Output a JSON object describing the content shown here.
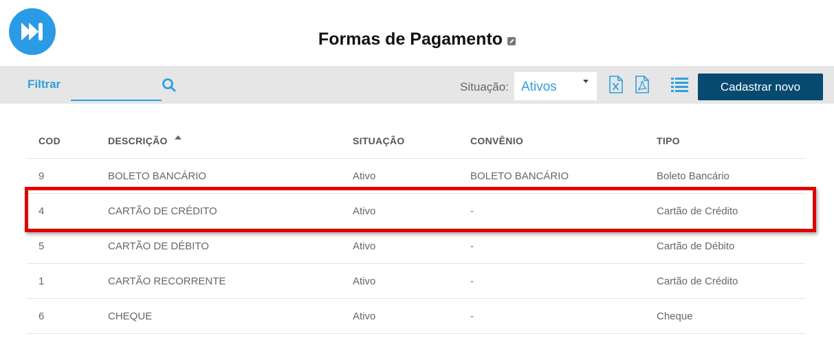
{
  "header": {
    "title": "Formas de Pagamento"
  },
  "toolbar": {
    "filter_label": "Filtrar",
    "filter_value": "",
    "situacao_label": "Situação:",
    "situacao_value": "Ativos",
    "new_button_label": "Cadastrar novo"
  },
  "icons": {
    "logo": "fast-forward-icon",
    "title_link": "external-link-icon",
    "search": "search-icon",
    "excel": "excel-icon",
    "pdf": "pdf-icon",
    "list": "list-icon"
  },
  "colors": {
    "accent": "#2d9fe0",
    "button": "#064a70",
    "toolbar_bg": "#e6e6e6",
    "highlight": "#e00000"
  },
  "table": {
    "columns": [
      "COD",
      "DESCRIÇÃO",
      "SITUAÇÃO",
      "CONVÊNIO",
      "TIPO"
    ],
    "sorted_column": "DESCRIÇÃO",
    "rows": [
      [
        "9",
        "BOLETO BANCÁRIO",
        "Ativo",
        "BOLETO BANCÁRIO",
        "Boleto Bancário"
      ],
      [
        "4",
        "CARTÃO DE CRÉDITO",
        "Ativo",
        "-",
        "Cartão de Crédito"
      ],
      [
        "5",
        "CARTÃO DE DÉBITO",
        "Ativo",
        "-",
        "Cartão de Débito"
      ],
      [
        "1",
        "CARTÃO RECORRENTE",
        "Ativo",
        "-",
        "Cartão de Crédito"
      ],
      [
        "6",
        "CHEQUE",
        "Ativo",
        "-",
        "Cheque"
      ]
    ],
    "highlighted_row": 1
  }
}
